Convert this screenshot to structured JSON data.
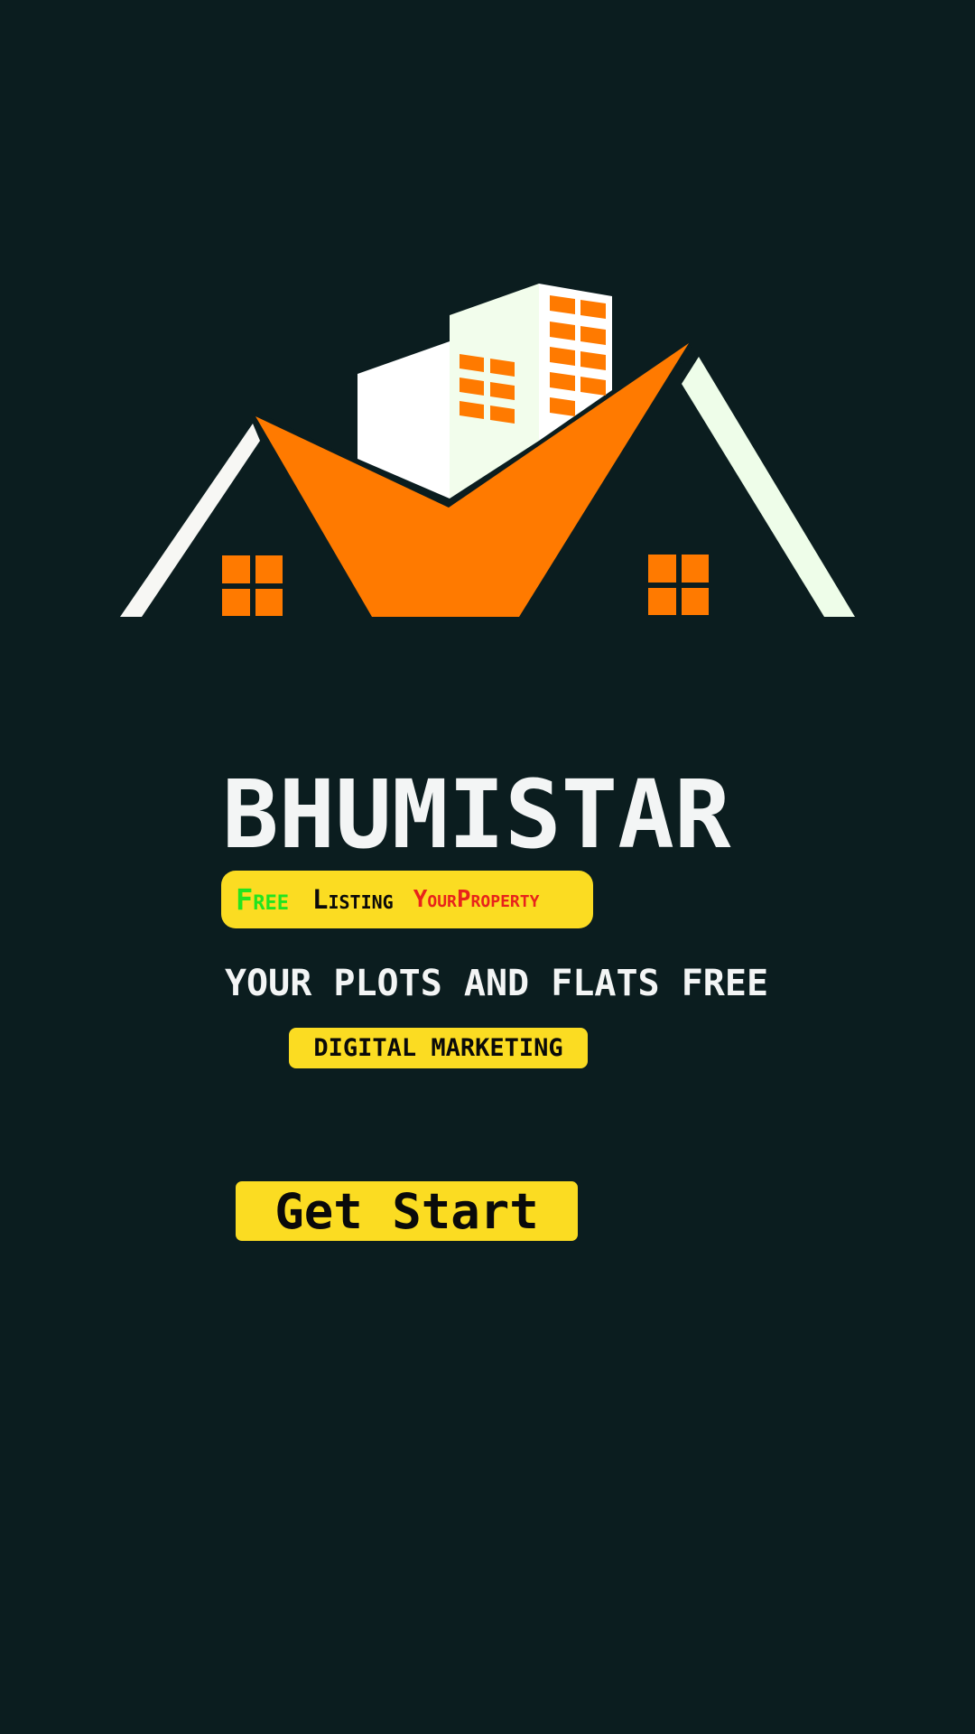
{
  "brand": {
    "title": "BHUMISTAR"
  },
  "free_listing_badge": {
    "word_free": "Free",
    "word_listing": "Listing",
    "word_property": "YourProperty"
  },
  "tagline": "YOUR PLOTS AND FLATS FREE",
  "digital_marketing_badge": "DIGITAL MARKETING",
  "cta": {
    "label": "Get Start"
  },
  "logo": {
    "icon": "house-buildings-logo-icon"
  },
  "colors": {
    "background": "#0b1d1f",
    "accent_orange": "#ff7a00",
    "badge_yellow": "#fbdc22",
    "title_white": "#f3f5f5",
    "free_green": "#22e41f",
    "property_red": "#e8231b"
  }
}
